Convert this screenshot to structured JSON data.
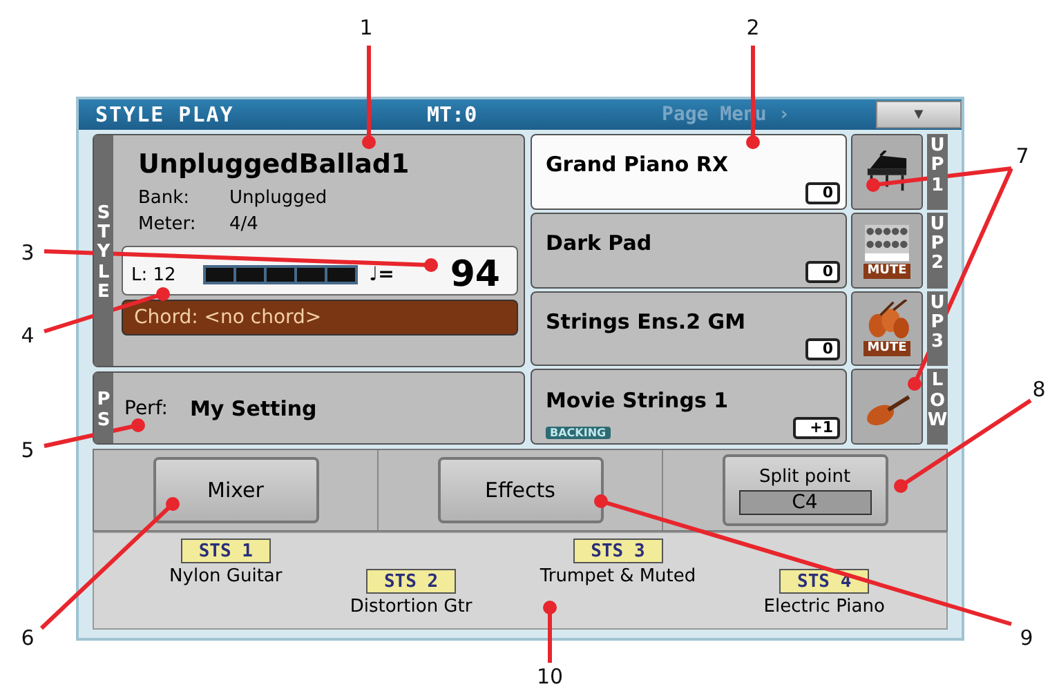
{
  "header": {
    "title": "STYLE PLAY",
    "mt": "MT:0",
    "page_menu": "Page Menu",
    "page_menu_arrow": "›",
    "dropdown": "▼"
  },
  "style": {
    "tab": "STYLE",
    "name": "UnpluggedBallad1",
    "bank_label": "Bank:",
    "bank": "Unplugged",
    "meter_label": "Meter:",
    "meter": "4/4",
    "length": "L: 12",
    "tempo_symbol": "♩=",
    "tempo": "94",
    "chord": "Chord: <no chord>"
  },
  "performance": {
    "tab": "PS",
    "label": "Perf:",
    "name": "My Setting"
  },
  "tracks": [
    {
      "name": "Grand Piano RX",
      "octave": "0",
      "selected": true,
      "kind": "piano",
      "tab": "UP1"
    },
    {
      "name": "Dark Pad",
      "octave": "0",
      "selected": false,
      "mute": "MUTE",
      "kind": "pad",
      "tab": "UP2"
    },
    {
      "name": "Strings Ens.2 GM",
      "octave": "0",
      "selected": false,
      "mute": "MUTE",
      "kind": "strings",
      "tab": "UP3"
    },
    {
      "name": "Movie Strings 1",
      "octave": "+1",
      "selected": false,
      "backing": "BACKING",
      "kind": "violin",
      "tab": "LOW"
    }
  ],
  "buttons": [
    {
      "kind": "button",
      "label": "Mixer"
    },
    {
      "kind": "button",
      "label": "Effects"
    },
    {
      "kind": "split",
      "label": "Split point",
      "value": "C4"
    }
  ],
  "sts": [
    {
      "label": "STS 1",
      "name": "Nylon Guitar",
      "kind": "top"
    },
    {
      "label": "STS 2",
      "name": "Distortion Gtr",
      "kind": "bottom"
    },
    {
      "label": "STS 3",
      "name": "Trumpet & Muted",
      "kind": "top"
    },
    {
      "label": "STS 4",
      "name": "Electric Piano",
      "kind": "bottom"
    }
  ],
  "callouts": [
    "1",
    "2",
    "3",
    "4",
    "5",
    "6",
    "7",
    "8",
    "9",
    "10"
  ]
}
